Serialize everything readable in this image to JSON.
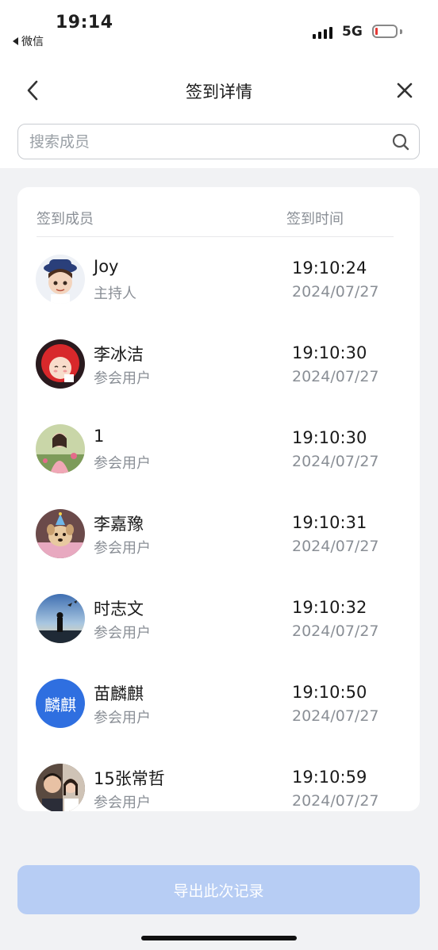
{
  "status_bar": {
    "time": "19:14",
    "back_app": "微信",
    "network": "5G"
  },
  "nav": {
    "title": "签到详情"
  },
  "search": {
    "placeholder": "搜索成员"
  },
  "table": {
    "col_member": "签到成员",
    "col_time": "签到时间"
  },
  "members": [
    {
      "name": "Joy",
      "role": "主持人",
      "time": "19:10:24",
      "date": "2024/07/27"
    },
    {
      "name": "李冰洁",
      "role": "参会用户",
      "time": "19:10:30",
      "date": "2024/07/27"
    },
    {
      "name": "1",
      "role": "参会用户",
      "time": "19:10:30",
      "date": "2024/07/27"
    },
    {
      "name": "李嘉豫",
      "role": "参会用户",
      "time": "19:10:31",
      "date": "2024/07/27"
    },
    {
      "name": "时志文",
      "role": "参会用户",
      "time": "19:10:32",
      "date": "2024/07/27"
    },
    {
      "name": "苗麟麒",
      "role": "参会用户",
      "time": "19:10:50",
      "date": "2024/07/27",
      "avatar_text": "麟麒"
    },
    {
      "name": "15张常哲",
      "role": "参会用户",
      "time": "19:10:59",
      "date": "2024/07/27"
    }
  ],
  "export": {
    "label": "导出此次记录"
  },
  "colors": {
    "accent_light": "#b7cdf4",
    "text_muted": "#8a8f96",
    "avatar_blue": "#2f6fe0"
  },
  "icons": [
    "chevron-left-icon",
    "close-icon",
    "search-icon",
    "signal-icon",
    "battery-icon"
  ]
}
